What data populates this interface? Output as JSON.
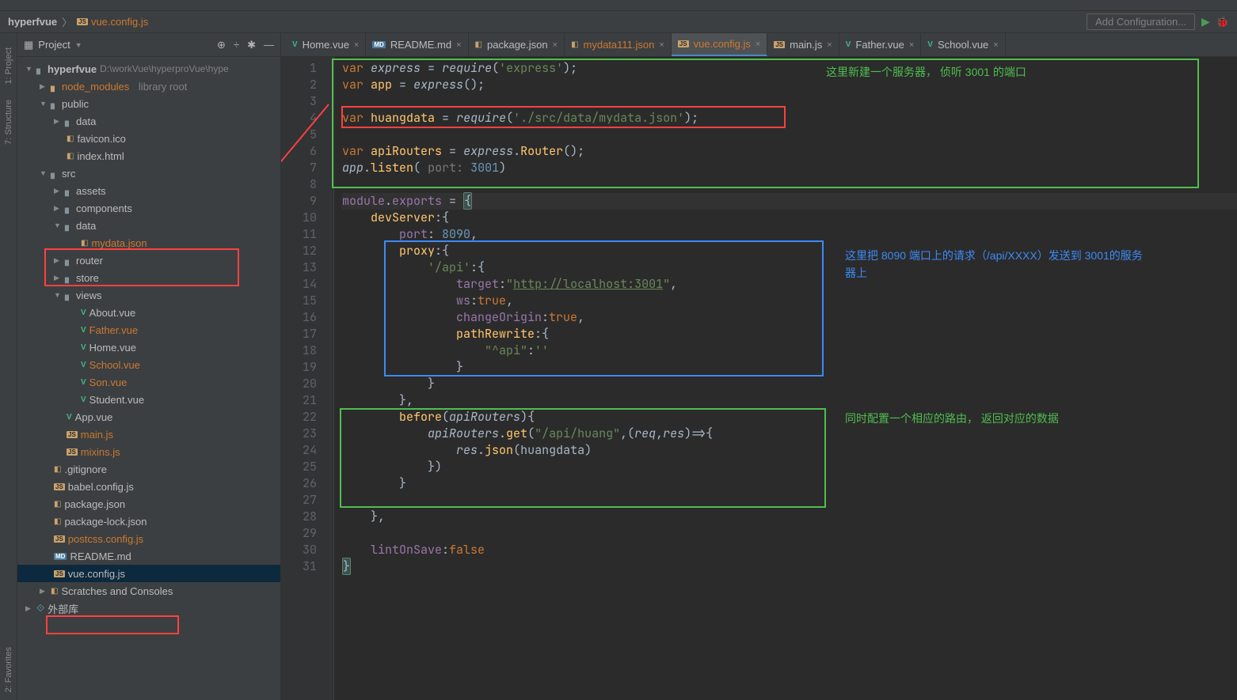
{
  "breadcrumb": {
    "root": "hyperfvue",
    "file": "vue.config.js",
    "sep": "〉"
  },
  "toolbar": {
    "add_config": "Add Configuration..."
  },
  "sidebar": {
    "title": "Project",
    "project_name": "hyperfvue",
    "project_path": "D:\\workVue\\hyperproVue\\hype",
    "node_modules": "node_modules",
    "lib_root": "library root",
    "folders": {
      "public": "public",
      "data": "data",
      "favicon": "favicon.ico",
      "index": "index.html",
      "src": "src",
      "assets": "assets",
      "components": "components",
      "data2": "data",
      "mydata": "mydata.json",
      "router": "router",
      "store": "store",
      "views": "views",
      "about": "About.vue",
      "father": "Father.vue",
      "home": "Home.vue",
      "school": "School.vue",
      "son": "Son.vue",
      "student": "Student.vue",
      "app": "App.vue",
      "mainjs": "main.js",
      "mixins": "mixins.js",
      "gitignore": ".gitignore",
      "babel": "babel.config.js",
      "packagejson": "package.json",
      "packagelock": "package-lock.json",
      "postcss": "postcss.config.js",
      "readme": "README.md",
      "vueconfig": "vue.config.js",
      "scratches": "Scratches and Consoles",
      "external": "外部库"
    }
  },
  "rail": {
    "project": "1: Project",
    "structure": "7: Structure",
    "favorites": "2: Favorites"
  },
  "tabs": [
    {
      "icon": "vue",
      "label": "Home.vue"
    },
    {
      "icon": "md",
      "label": "README.md"
    },
    {
      "icon": "json",
      "label": "package.json"
    },
    {
      "icon": "json",
      "label": "mydata111.json",
      "hl": true
    },
    {
      "icon": "js",
      "label": "vue.config.js",
      "active": true
    },
    {
      "icon": "js",
      "label": "main.js"
    },
    {
      "icon": "vue",
      "label": "Father.vue"
    },
    {
      "icon": "vue",
      "label": "School.vue"
    }
  ],
  "code": {
    "lines": [
      "var express = require('express');",
      "var app = express();",
      "",
      "var huangdata = require('./src/data/mydata.json');",
      "",
      "var apiRouters = express.Router();",
      "app.listen( port: 3001)",
      "",
      "module.exports = {",
      "    devServer:{",
      "        port: 8090,",
      "        proxy:{",
      "            '/api':{",
      "                target:\"http://localhost:3001\",",
      "                ws:true,",
      "                changeOrigin:true,",
      "                pathRewrite:{",
      "                    \"^api\":''",
      "                }",
      "            }",
      "        },",
      "        before(apiRouters){",
      "            apiRouters.get(\"/api/huang\",(req,res)=>{",
      "                res.json(huangdata)",
      "            })",
      "        }",
      "",
      "    },",
      "",
      "    lintOnSave:false",
      "}"
    ]
  },
  "annotations": {
    "green1": "这里新建一个服务器， 侦听 3001 的端口",
    "blue1": "这里把 8090 端口上的请求（/api/XXXX）发送到 3001的服务器上",
    "green2": "同时配置一个相应的路由， 返回对应的数据"
  }
}
